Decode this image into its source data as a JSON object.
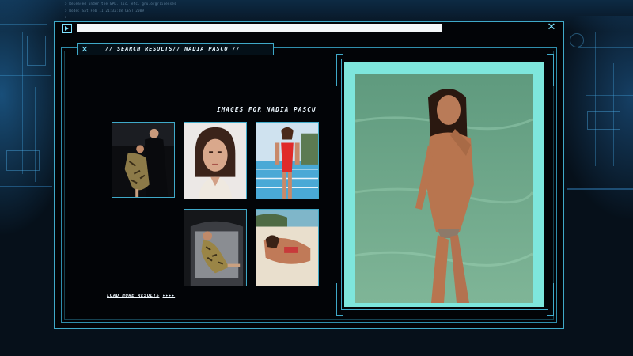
{
  "window": {
    "url": "",
    "play_icon": "play-icon",
    "close_icon": "close-icon"
  },
  "header": {
    "title": "// SEARCH RESULTS// NADIA PASCU //",
    "icon": "close-icon"
  },
  "results": {
    "heading": "IMAGES FOR NADIA PASCU",
    "thumbnails": [
      "image-result-1",
      "image-result-2",
      "image-result-3",
      "image-result-4",
      "image-result-5"
    ],
    "load_more": "LOAD MORE RESULTS",
    "load_more_arrows": "▸▸▸▸"
  },
  "preview": {
    "alt": "selected image preview"
  },
  "colors": {
    "accent": "#3fa9c8",
    "accent_light": "#7fe3ff",
    "preview_mat": "#7ee6dc",
    "background": "#020407"
  }
}
